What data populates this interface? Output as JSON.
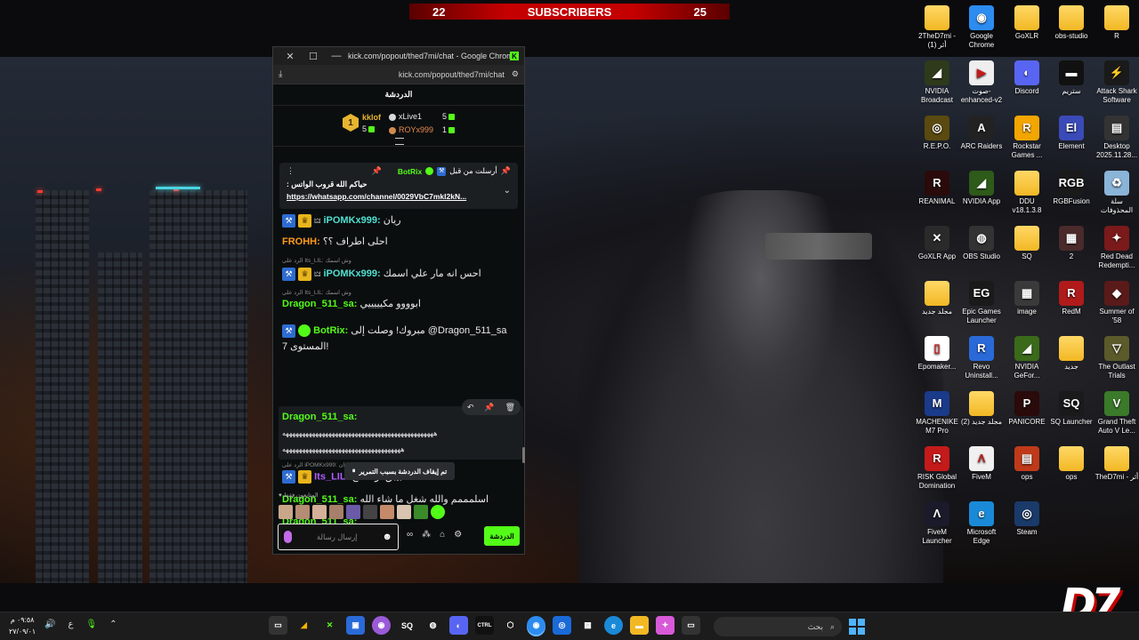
{
  "subscriber_banner": {
    "current": "22",
    "label": "SUBSCRIBERS",
    "goal": "25"
  },
  "desktop_icons": [
    {
      "label": "2TheD7mi - أثر (1)",
      "color": "#f2b824",
      "glyph": "",
      "kind": "folder"
    },
    {
      "label": "Google Chrome",
      "color": "#2d8cf0",
      "glyph": "◉",
      "kind": "app"
    },
    {
      "label": "GoXLR",
      "color": "#f2b824",
      "glyph": "",
      "kind": "folder"
    },
    {
      "label": "obs-studio",
      "color": "#f2b824",
      "glyph": "",
      "kind": "folder"
    },
    {
      "label": "R",
      "color": "#f2b824",
      "glyph": "",
      "kind": "folder"
    },
    {
      "label": "NVIDIA Broadcast",
      "color": "#2e3a1a",
      "glyph": "◢",
      "kind": "app"
    },
    {
      "label": "صوت-enhanced-v2",
      "color": "#eeeeee",
      "glyph": "▶",
      "kind": "app"
    },
    {
      "label": "Discord",
      "color": "#5865f2",
      "glyph": "◐",
      "kind": "app"
    },
    {
      "label": "ستريم",
      "color": "#111111",
      "glyph": "▬",
      "kind": "app"
    },
    {
      "label": "Attack Shark Software",
      "color": "#1a1a1a",
      "glyph": "⚡",
      "kind": "app"
    },
    {
      "label": "R.E.P.O.",
      "color": "#5a4a10",
      "glyph": "◎",
      "kind": "app"
    },
    {
      "label": "ARC Raiders",
      "color": "#222222",
      "glyph": "A",
      "kind": "app"
    },
    {
      "label": "Rockstar Games ...",
      "color": "#f4a600",
      "glyph": "R",
      "kind": "app"
    },
    {
      "label": "Element",
      "color": "#3a4ab8",
      "glyph": "El",
      "kind": "app"
    },
    {
      "label": "Desktop 2025.11.28...",
      "color": "#333333",
      "glyph": "▤",
      "kind": "app"
    },
    {
      "label": "REANIMAL",
      "color": "#2a0a0a",
      "glyph": "R",
      "kind": "app"
    },
    {
      "label": "NVIDIA App",
      "color": "#2e5a1a",
      "glyph": "◢",
      "kind": "app"
    },
    {
      "label": "DDU v18.1.3.8",
      "color": "#f2b824",
      "glyph": "",
      "kind": "folder"
    },
    {
      "label": "RGBFusion",
      "color": "#1a1a1a",
      "glyph": "RGB",
      "kind": "app"
    },
    {
      "label": "سلة المحذوفات",
      "color": "#8ab4d8",
      "glyph": "♻",
      "kind": "app"
    },
    {
      "label": "GoXLR App",
      "color": "#2a2a2a",
      "glyph": "✕",
      "kind": "app"
    },
    {
      "label": "OBS Studio",
      "color": "#333333",
      "glyph": "◍",
      "kind": "app"
    },
    {
      "label": "SQ",
      "color": "#f2b824",
      "glyph": "",
      "kind": "folder"
    },
    {
      "label": "2",
      "color": "#4a2a2a",
      "glyph": "▦",
      "kind": "app"
    },
    {
      "label": "Red Dead Redempti...",
      "color": "#7a1a1a",
      "glyph": "✦",
      "kind": "app"
    },
    {
      "label": "مجلد جديد",
      "color": "#f2b824",
      "glyph": "",
      "kind": "folder"
    },
    {
      "label": "Epic Games Launcher",
      "color": "#1a1a1a",
      "glyph": "EG",
      "kind": "app"
    },
    {
      "label": "image",
      "color": "#3a3a3a",
      "glyph": "▦",
      "kind": "app"
    },
    {
      "label": "RedM",
      "color": "#b01a1a",
      "glyph": "R",
      "kind": "app"
    },
    {
      "label": "Summer of '58",
      "color": "#5a1a1a",
      "glyph": "◆",
      "kind": "app"
    },
    {
      "label": "Epomaker...",
      "color": "#ffffff",
      "glyph": "▯",
      "kind": "app"
    },
    {
      "label": "Revo Uninstall...",
      "color": "#2a6ad8",
      "glyph": "R",
      "kind": "app"
    },
    {
      "label": "NVIDIA GeFor...",
      "color": "#3a6a1a",
      "glyph": "◢",
      "kind": "app"
    },
    {
      "label": "جديد",
      "color": "#f2b824",
      "glyph": "",
      "kind": "folder"
    },
    {
      "label": "The Outlast Trials",
      "color": "#5a5a2a",
      "glyph": "▽",
      "kind": "app"
    },
    {
      "label": "MACHENIKE M7 Pro",
      "color": "#1a3a8a",
      "glyph": "M",
      "kind": "app"
    },
    {
      "label": "مجلد جديد (2)",
      "color": "#f2b824",
      "glyph": "",
      "kind": "folder"
    },
    {
      "label": "PANICORE",
      "color": "#2a0a0a",
      "glyph": "P",
      "kind": "app"
    },
    {
      "label": "SQ Launcher",
      "color": "#1a1a1a",
      "glyph": "SQ",
      "kind": "app"
    },
    {
      "label": "Grand Theft Auto V Le...",
      "color": "#3a7a2a",
      "glyph": "V",
      "kind": "app"
    },
    {
      "label": "RISK Global Domination",
      "color": "#c41a1a",
      "glyph": "R",
      "kind": "app"
    },
    {
      "label": "FiveM",
      "color": "#f0f0f0",
      "glyph": "Λ",
      "kind": "app"
    },
    {
      "label": "ops",
      "color": "#c03a1a",
      "glyph": "▤",
      "kind": "app"
    },
    {
      "label": "ops",
      "color": "#f2b824",
      "glyph": "",
      "kind": "folder"
    },
    {
      "label": "TheD7mi - أثر",
      "color": "#f2b824",
      "glyph": "",
      "kind": "folder"
    },
    {
      "label": "FiveM Launcher",
      "color": "#1a1a2a",
      "glyph": "Λ",
      "kind": "app"
    },
    {
      "label": "Microsoft Edge",
      "color": "#1a8ad8",
      "glyph": "e",
      "kind": "app"
    },
    {
      "label": "Steam",
      "color": "#1a3a6a",
      "glyph": "◎",
      "kind": "app"
    }
  ],
  "popup": {
    "window_title": "kick.com/popout/thed7mi/chat - Google Chrome",
    "url": "kick.com/popout/thed7mi/chat",
    "chat_title": "الدردشة",
    "leaderboard": {
      "first": {
        "rank": "1",
        "name": "kklof",
        "count": "5"
      },
      "second": {
        "name": "xLive1",
        "count": "5"
      },
      "third": {
        "name": "ROYx999",
        "count": "1"
      }
    },
    "pinned": {
      "pinned_by": "أرسلت من قبل",
      "author": "BotRix",
      "text": "حياكم الله قروب الواتس :",
      "link": "https://whatsapp.com/channel/0029VbC7mkI2kN..."
    },
    "messages": [
      {
        "user": "iPOMKx999",
        "text": "ريان",
        "reply": ""
      },
      {
        "user": "FROHH",
        "text": "احلى اطراف ؟؟",
        "reply": ""
      },
      {
        "user": "iPOMKx999",
        "text": "احس انه مار علي اسمك",
        "reply": "الرد على Its_LIL: وش اسمك"
      },
      {
        "user": "Dragon_511_sa",
        "text": "ابوووو مكيييييي",
        "reply": "الرد على Its_LIL: وش اسمك"
      },
      {
        "user": "BotRix",
        "text": "مبروك! وصلت إلى @Dragon_511_sa",
        "text2": "المستوى 7!",
        "reply": ""
      },
      {
        "user": "Dragon_511_sa",
        "text": "ههههههههههههههههههههههههههههههههههههههههههههههه",
        "text2": "ههههههههههههههههههههههههههههههههههههه",
        "reply": ""
      },
      {
        "user": "Its_LIL",
        "text": "كنت بيبق تونا صح",
        "reply": "الرد على iPOMKx999: ريان"
      },
      {
        "user": "Dragon_511_sa",
        "text": "اسلمممم والله شغل ما شاء الله",
        "reply": ""
      },
      {
        "user": "Dragon_511_sa",
        "text": "",
        "reply": ""
      }
    ],
    "pause_tooltip": "تم إيقاف الدردشة بسبب التمرير",
    "followers_only": "المتابعون فقط",
    "input_placeholder": "إرسال رسالة",
    "send_label": "الدردشة"
  },
  "taskbar": {
    "time": "٠٩:٥٨ م",
    "date": "٢٧/٠٩/٠١",
    "search_placeholder": "بحث",
    "lang": "ع"
  },
  "brand_logo": "D7"
}
